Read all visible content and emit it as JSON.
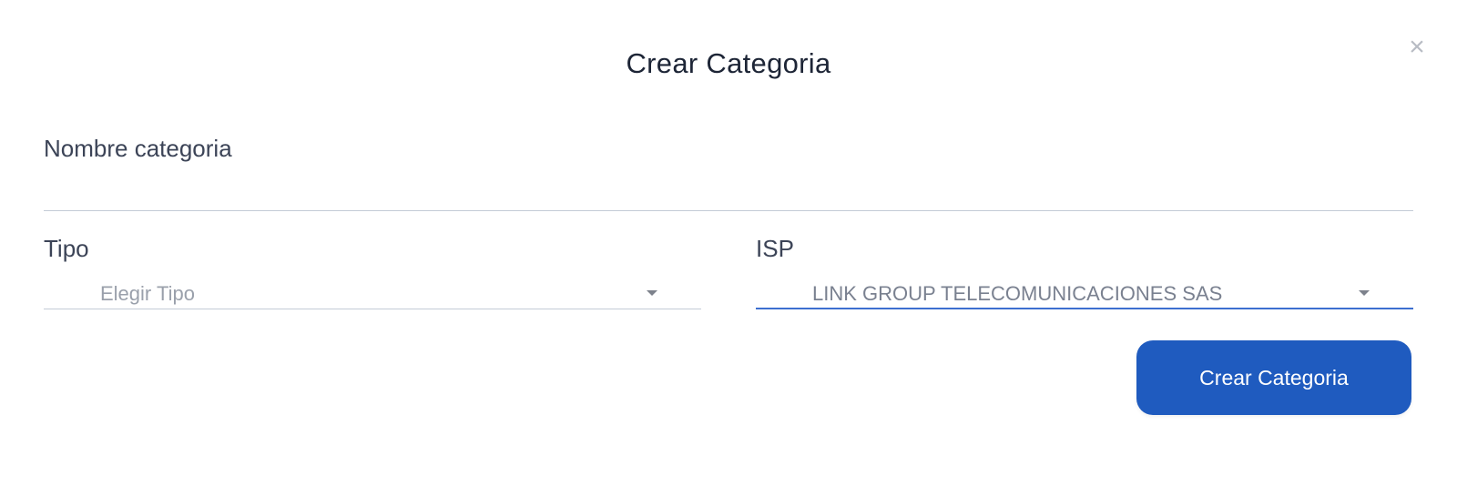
{
  "modal": {
    "title": "Crear Categoria",
    "close_icon": "close-icon",
    "close_glyph": "×"
  },
  "form": {
    "nombre": {
      "label": "Nombre categoria",
      "value": "",
      "placeholder": ""
    },
    "tipo": {
      "label": "Tipo",
      "selected": "Elegir Tipo"
    },
    "isp": {
      "label": "ISP",
      "selected": "LINK GROUP TELECOMUNICACIONES SAS"
    },
    "submit_label": "Crear Categoria"
  },
  "colors": {
    "accent": "#1f5bbf",
    "focus_underline": "#3d6fd0",
    "title_text": "#1d2536"
  }
}
